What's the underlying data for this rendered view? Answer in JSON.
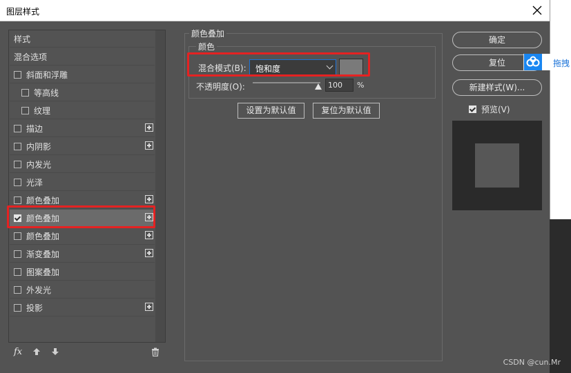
{
  "window": {
    "title": "图层样式"
  },
  "style_list": {
    "items": [
      {
        "label": "样式",
        "checkbox": false,
        "checked": false,
        "plus": false,
        "indent": 0
      },
      {
        "label": "混合选项",
        "checkbox": false,
        "checked": false,
        "plus": false,
        "indent": 0
      },
      {
        "label": "斜面和浮雕",
        "checkbox": true,
        "checked": false,
        "plus": false,
        "indent": 0
      },
      {
        "label": "等高线",
        "checkbox": true,
        "checked": false,
        "plus": false,
        "indent": 1
      },
      {
        "label": "纹理",
        "checkbox": true,
        "checked": false,
        "plus": false,
        "indent": 1
      },
      {
        "label": "描边",
        "checkbox": true,
        "checked": false,
        "plus": true,
        "indent": 0
      },
      {
        "label": "内阴影",
        "checkbox": true,
        "checked": false,
        "plus": true,
        "indent": 0
      },
      {
        "label": "内发光",
        "checkbox": true,
        "checked": false,
        "plus": false,
        "indent": 0
      },
      {
        "label": "光泽",
        "checkbox": true,
        "checked": false,
        "plus": false,
        "indent": 0
      },
      {
        "label": "颜色叠加",
        "checkbox": true,
        "checked": false,
        "plus": true,
        "indent": 0
      },
      {
        "label": "颜色叠加",
        "checkbox": true,
        "checked": true,
        "plus": true,
        "indent": 0,
        "selected": true
      },
      {
        "label": "颜色叠加",
        "checkbox": true,
        "checked": false,
        "plus": true,
        "indent": 0
      },
      {
        "label": "渐变叠加",
        "checkbox": true,
        "checked": false,
        "plus": true,
        "indent": 0
      },
      {
        "label": "图案叠加",
        "checkbox": true,
        "checked": false,
        "plus": false,
        "indent": 0
      },
      {
        "label": "外发光",
        "checkbox": true,
        "checked": false,
        "plus": false,
        "indent": 0
      },
      {
        "label": "投影",
        "checkbox": true,
        "checked": false,
        "plus": true,
        "indent": 0
      }
    ],
    "footer_icons": [
      "fx-icon",
      "arrow-up-icon",
      "arrow-down-icon",
      "trash-icon"
    ],
    "fx_label": "fx"
  },
  "panel": {
    "group_title": "颜色叠加",
    "sub_title": "颜色",
    "blend_mode_label": "混合模式(B):",
    "blend_mode_value": "饱和度",
    "overlay_color": "#7a7a7a",
    "opacity_label": "不透明度(O):",
    "opacity_value": "100",
    "opacity_unit": "%",
    "opacity_level": 1.0,
    "set_default": "设置为默认值",
    "reset_default": "复位为默认值"
  },
  "actions": {
    "ok": "确定",
    "reset": "复位",
    "new_style": "新建样式(W)...",
    "preview_label": "预览(V)",
    "preview_checked": true
  },
  "overlay": {
    "baidu_text": "拖拽",
    "watermark": "CSDN @cun.Mr"
  },
  "colors": {
    "highlight_red": "#e52222",
    "dropdown_focus": "#1e74d6"
  }
}
